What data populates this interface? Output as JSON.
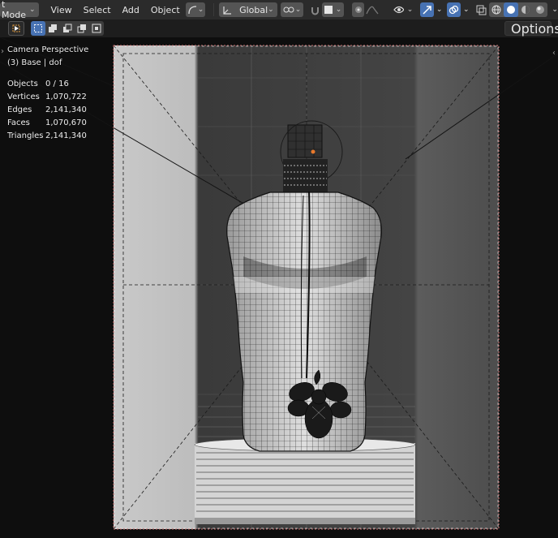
{
  "header": {
    "mode": "t Mode",
    "menus": [
      "View",
      "Select",
      "Add",
      "Object"
    ],
    "orientation": "Global",
    "options_label": "Options"
  },
  "overlay": {
    "view_name": "Camera Perspective",
    "collection": "(3) Base | dof"
  },
  "stats": [
    {
      "label": "Objects",
      "value": "0 / 16"
    },
    {
      "label": "Vertices",
      "value": "1,070,722"
    },
    {
      "label": "Edges",
      "value": "2,141,340"
    },
    {
      "label": "Faces",
      "value": "1,070,670"
    },
    {
      "label": "Triangles",
      "value": "2,141,340"
    }
  ],
  "colors": {
    "accent": "#4772b3",
    "header_bg": "#2b2b2b",
    "button_bg": "#545454",
    "viewport_bg": "#0e0e0e",
    "camera_frame": "#c87070"
  },
  "icons": [
    "editor-type-icon",
    "select-box-icon",
    "select-extend-icon",
    "select-subtract-icon",
    "select-invert-icon",
    "select-intersect-icon",
    "transform-orientation-icon",
    "transform-pivot-icon",
    "snap-icon",
    "snap-increment-icon",
    "proportional-editing-icon",
    "proportional-falloff-icon",
    "visibility-icon",
    "gizmo-icon",
    "overlay-icon",
    "xray-icon",
    "wireframe-shading-icon",
    "solid-shading-icon",
    "material-shading-icon",
    "rendered-shading-icon"
  ]
}
